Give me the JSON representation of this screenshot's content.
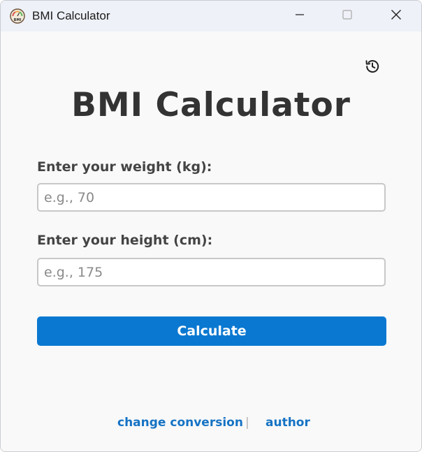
{
  "window": {
    "title": "BMI Calculator"
  },
  "app_icon": {
    "icon": "bmi-gauge-icon",
    "text": "BMI"
  },
  "titlebar_controls": {
    "minimize_icon": "minimize-icon",
    "maximize_icon": "maximize-icon",
    "close_icon": "close-icon"
  },
  "header": {
    "history_icon": "history-icon",
    "title": "BMI Calculator"
  },
  "form": {
    "weight_label": "Enter your weight (kg):",
    "weight_placeholder": "e.g., 70",
    "weight_value": "",
    "height_label": "Enter your height (cm):",
    "height_placeholder": "e.g., 175",
    "height_value": "",
    "calculate_label": "Calculate"
  },
  "footer": {
    "change_conversion": "change conversion",
    "separator": "|",
    "author": "author"
  },
  "colors": {
    "accent": "#0a78d1",
    "link": "#1673c4",
    "title_text": "#333333",
    "background": "#f9f9f9",
    "titlebar": "#eef1f7"
  }
}
